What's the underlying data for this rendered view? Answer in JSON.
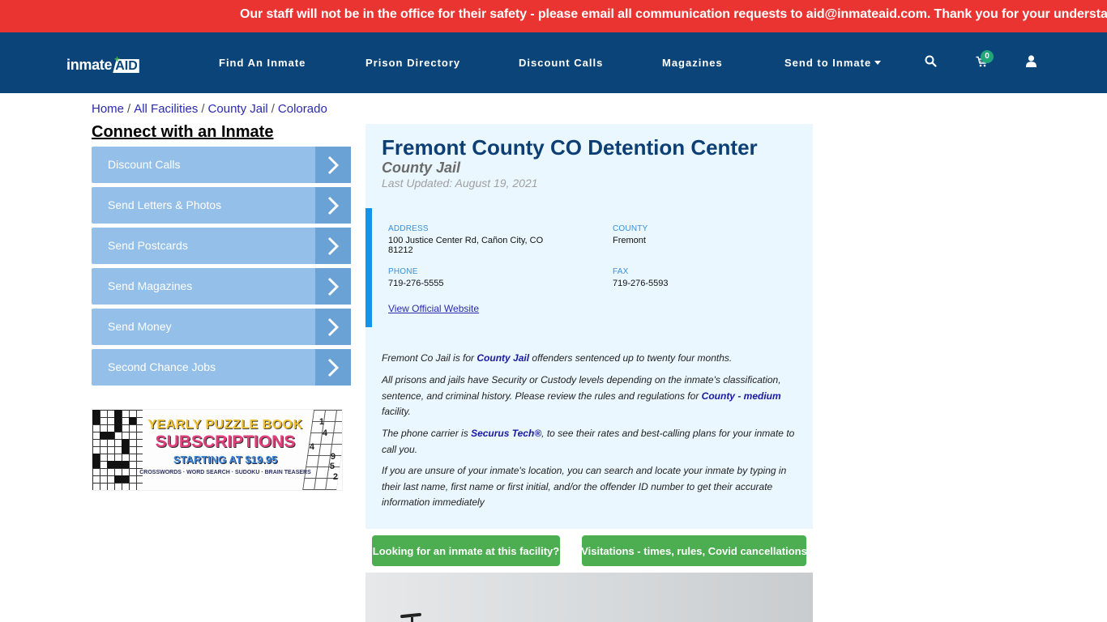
{
  "alert": {
    "text": "Our staff will not be in the office for their safety - please email all communication requests to aid@inmateaid.com. Thank you for your understanding."
  },
  "navbar": {
    "logo": {
      "part1": "inmate",
      "part2": "AID",
      "plus": "+"
    },
    "links": [
      {
        "label": "Find An Inmate"
      },
      {
        "label": "Prison Directory"
      },
      {
        "label": "Discount Calls"
      },
      {
        "label": "Magazines"
      },
      {
        "label": "Send to Inmate"
      }
    ],
    "icons": {
      "search": "search-icon",
      "cart": "cart-icon",
      "user": "user-icon"
    },
    "cart_count": "0",
    "colors": {
      "background": "#0b4478",
      "badge": "#21a67a"
    }
  },
  "breadcrumb": {
    "items": [
      "Home",
      "All Facilities",
      "County Jail",
      "Colorado"
    ],
    "separator": "/"
  },
  "sidebar": {
    "title": "Connect with an Inmate",
    "items": [
      {
        "label": "Discount Calls"
      },
      {
        "label": "Send Letters & Photos"
      },
      {
        "label": "Send Postcards"
      },
      {
        "label": "Send Magazines"
      },
      {
        "label": "Send Money"
      },
      {
        "label": "Second Chance Jobs"
      }
    ],
    "ad": {
      "line1": "YEARLY PUZZLE BOOK",
      "line2": "SUBSCRIPTIONS",
      "line3": "STARTING AT $19.95",
      "line4": "CROSSWORDS · WORD SEARCH · SUDOKU · BRAIN TEASERS",
      "sudoku_digits": [
        "1",
        "4",
        "4",
        "9",
        "5",
        "2"
      ]
    }
  },
  "facility": {
    "title": "Fremont County CO Detention Center",
    "type": "County Jail",
    "last_updated": "Last Updated: August 19, 2021",
    "info": {
      "address_label": "ADDRESS",
      "address_line1": "100 Justice Center Rd, Cañon City, CO",
      "address_line2": "81212",
      "county_label": "COUNTY",
      "county": "Fremont",
      "phone_label": "PHONE",
      "phone": "719-276-5555",
      "fax_label": "FAX",
      "fax": "719-276-5593",
      "website_link": "View Official Website"
    },
    "description": {
      "p1_pre": "Fremont Co Jail is for ",
      "p1_link": "County Jail",
      "p1_post": " offenders sentenced up to twenty four months.",
      "p2_pre": "All prisons and jails have Security or Custody levels depending on the inmate's classification, sentence, and criminal history. Please review the rules and regulations for ",
      "p2_link": "County - medium",
      "p2_post": " facility.",
      "p3_pre": "The phone carrier is ",
      "p3_link": "Securus Tech®",
      "p3_post": ", to see their rates and best-calling plans for your inmate to call you.",
      "p4": "If you are unsure of your inmate's location, you can search and locate your inmate by typing in their last name, first name or first initial, and/or the offender ID number to get their accurate information immediately"
    },
    "buttons": {
      "find_inmate": "Looking for an inmate at this facility?",
      "visitations": "Visitations - times, rules, Covid cancellations"
    },
    "colors": {
      "title": "#0d3f75",
      "card_bg": "#eaf7fe",
      "accent_border": "#1393ea",
      "button": "#4cae50"
    }
  }
}
